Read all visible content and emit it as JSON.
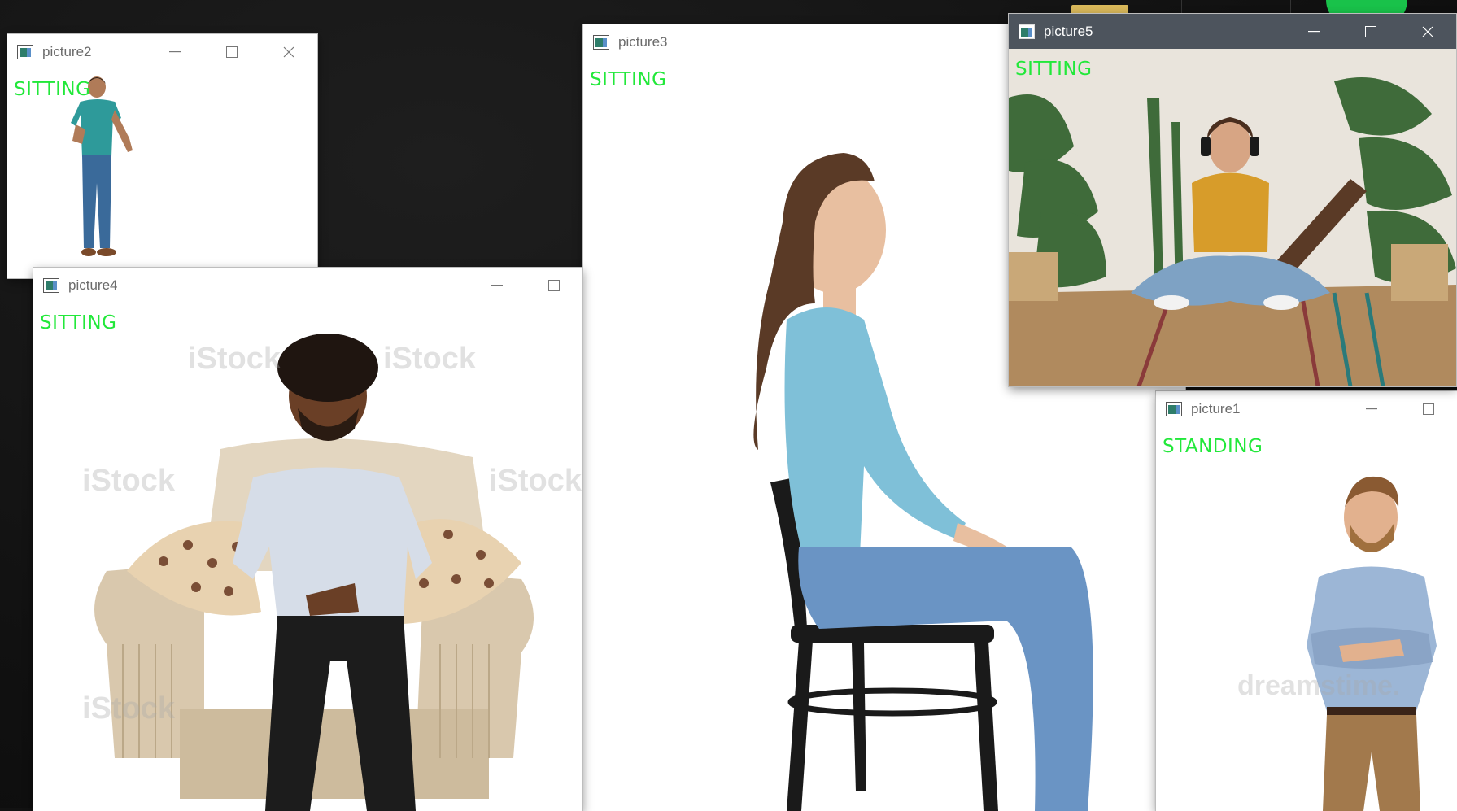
{
  "windows": [
    {
      "id": "picture2",
      "title": "picture2",
      "label": "SITTING"
    },
    {
      "id": "picture4",
      "title": "picture4",
      "label": "SITTING"
    },
    {
      "id": "picture3",
      "title": "picture3",
      "label": "SITTING"
    },
    {
      "id": "picture5",
      "title": "picture5",
      "label": "SITTING"
    },
    {
      "id": "picture1",
      "title": "picture1",
      "label": "STANDING"
    }
  ],
  "icons": {
    "app": "window-app-icon",
    "minimize": "minimize-icon",
    "maximize": "maximize-icon",
    "close": "close-icon"
  },
  "colors": {
    "label_green": "#22e83a",
    "active_titlebar": "#4d545d",
    "inactive_titlebar": "#ffffff"
  }
}
